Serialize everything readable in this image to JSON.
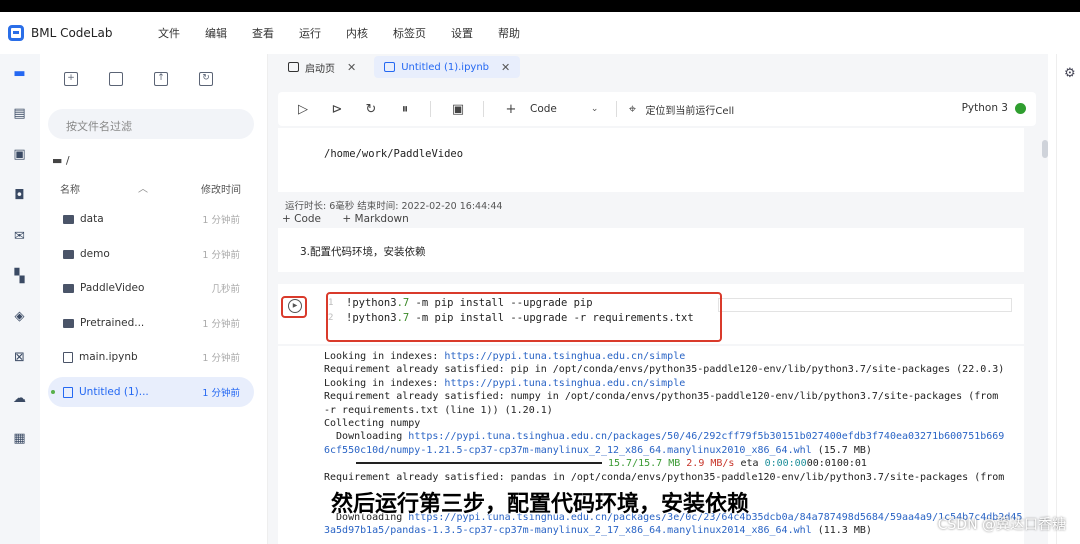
{
  "app": {
    "name": "BML CodeLab"
  },
  "menu": [
    "文件",
    "编辑",
    "查看",
    "运行",
    "内核",
    "标签页",
    "设置",
    "帮助"
  ],
  "filter_placeholder": "按文件名过滤",
  "path": "/",
  "file_header": {
    "name": "名称",
    "time": "修改时间"
  },
  "files": [
    {
      "name": "data",
      "time": "1 分钟前",
      "type": "folder"
    },
    {
      "name": "demo",
      "time": "1 分钟前",
      "type": "folder"
    },
    {
      "name": "PaddleVideo",
      "time": "几秒前",
      "type": "folder"
    },
    {
      "name": "Pretrained...",
      "time": "1 分钟前",
      "type": "folder"
    },
    {
      "name": "main.ipynb",
      "time": "1 分钟前",
      "type": "notebook"
    },
    {
      "name": "Untitled (1)...",
      "time": "1 分钟前",
      "type": "notebook",
      "selected": true
    }
  ],
  "tabs": [
    {
      "label": "启动页"
    },
    {
      "label": "Untitled (1).ipynb"
    }
  ],
  "toolbar": {
    "cell_type": "Code",
    "locate": "定位到当前运行Cell",
    "kernel": "Python 3"
  },
  "notebook": {
    "out1": "/home/work/PaddleVideo",
    "runinfo": "运行时长: 6毫秒    结束时间: 2022-02-20 16:44:44",
    "add_code": "+ Code",
    "add_md": "+ Markdown",
    "md_text": "3.配置代码环境，安装依赖",
    "code_lines": [
      {
        "num": "1",
        "pre": "!python3",
        "num_part": ".7",
        "post": " -m pip install --upgrade pip"
      },
      {
        "num": "2",
        "pre": "!python3",
        "num_part": ".7",
        "post": " -m pip install --upgrade -r requirements.txt"
      }
    ],
    "output": [
      {
        "a": "Looking in indexes: ",
        "link": "https://pypi.tuna.tsinghua.edu.cn/simple",
        "b": ""
      },
      {
        "a": "Requirement already satisfied: pip in /opt/conda/envs/python35-paddle120-env/lib/python3.7/site-packages (22.0.3)",
        "link": "",
        "b": ""
      },
      {
        "a": "Looking in indexes: ",
        "link": "https://pypi.tuna.tsinghua.edu.cn/simple",
        "b": ""
      },
      {
        "a": "Requirement already satisfied: numpy in /opt/conda/envs/python35-paddle120-env/lib/python3.7/site-packages (from",
        "link": "",
        "b": ""
      },
      {
        "a": "-r requirements.txt (line 1)) (1.20.1)",
        "link": "",
        "b": ""
      },
      {
        "a": "Collecting numpy",
        "link": "",
        "b": ""
      },
      {
        "a": "  Downloading ",
        "link": "https://pypi.tuna.tsinghua.edu.cn/packages/50/46/292cff79f5b30151b027400efdb3f740ea03271b600751b669",
        "b": ""
      },
      {
        "a": "",
        "link": "6cf550c10d/numpy-1.21.5-cp37-cp37m-manylinux_2_12_x86_64.manylinux2010_x86_64.whl",
        "b": " (15.7 MB)"
      },
      {
        "a": "",
        "link": "",
        "b": ""
      },
      {
        "a": "Requirement already satisfied: pandas in /opt/conda/envs/python35-paddle120-env/lib/python3.7/site-packages (from",
        "link": "",
        "b": ""
      },
      {
        "a": "",
        "link": "",
        "b": ""
      },
      {
        "a": "  Downloading ",
        "link": "https://pypi.tuna.tsinghua.edu.cn/packages/3e/0c/23/64c4b35dcb0a/84a787498d5684/59aa4a9/1c54b7c4db2d45",
        "b": ""
      },
      {
        "a": "",
        "link": "3a5d97b1a5/pandas-1.3.5-cp37-cp37m-manylinux_2_17_x86_64.manylinux2014_x86_64.whl",
        "b": " (11.3 MB)"
      }
    ],
    "progress": {
      "size": "15.7/15.7 MB",
      "rate": "2.9 MB/s",
      "eta_label": " eta ",
      "eta": "0:00:00",
      "tail": "00:0100:01"
    }
  },
  "caption": "然后运行第三步，配置代码环境，安装依赖",
  "watermark": "CSDN @翼达口香糖"
}
